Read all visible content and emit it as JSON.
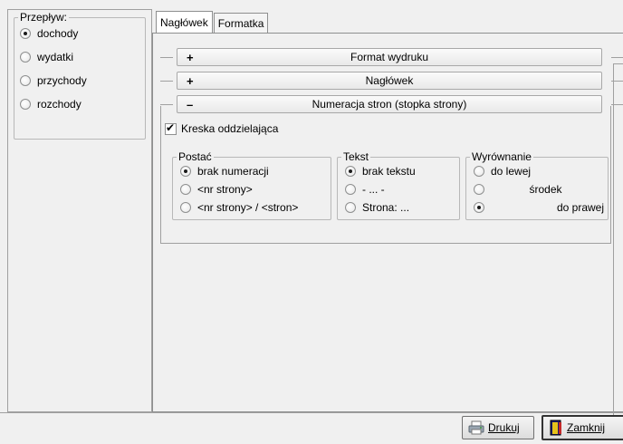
{
  "left": {
    "group_title": "Przepływ:",
    "options": [
      {
        "label": "dochody",
        "checked": true
      },
      {
        "label": "wydatki",
        "checked": false
      },
      {
        "label": "przychody",
        "checked": false
      },
      {
        "label": "rozchody",
        "checked": false
      }
    ]
  },
  "tabs": [
    {
      "label": "Nagłówek",
      "active": true
    },
    {
      "label": "Formatka",
      "active": false
    }
  ],
  "sections": [
    {
      "sign": "+",
      "label": "Format wydruku"
    },
    {
      "sign": "+",
      "label": "Nagłówek"
    },
    {
      "sign": "–",
      "label": "Numeracja stron (stopka strony)"
    }
  ],
  "separator_checkbox": {
    "label": "Kreska oddzielająca",
    "checked": true
  },
  "postac": {
    "title": "Postać",
    "options": [
      {
        "label": "brak numeracji",
        "checked": true
      },
      {
        "label": "<nr strony>",
        "checked": false
      },
      {
        "label": "<nr strony> / <stron>",
        "checked": false
      }
    ]
  },
  "tekst": {
    "title": "Tekst",
    "options": [
      {
        "label": "brak tekstu",
        "checked": true
      },
      {
        "label": "- ... -",
        "checked": false
      },
      {
        "label": "Strona: ...",
        "checked": false
      }
    ]
  },
  "wyrownanie": {
    "title": "Wyrównanie",
    "options": [
      {
        "label": "do lewej",
        "checked": false
      },
      {
        "label": "środek",
        "checked": false
      },
      {
        "label": "do prawej",
        "checked": true
      }
    ]
  },
  "buttons": {
    "print_label": "Drukuj",
    "close_label": "Zamknij"
  }
}
